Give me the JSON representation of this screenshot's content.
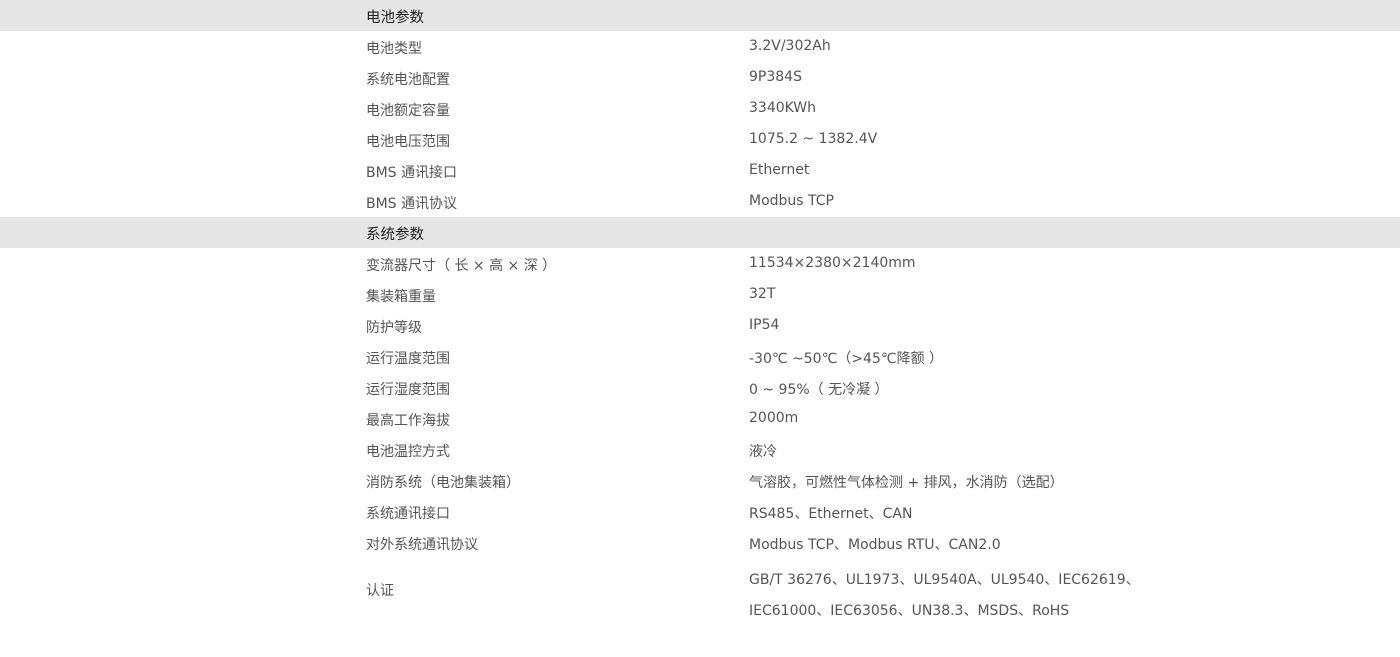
{
  "sections": [
    {
      "title": "电池参数",
      "rows": [
        {
          "label": "电池类型",
          "value": "3.2V/302Ah"
        },
        {
          "label": "系统电池配置",
          "value": "9P384S"
        },
        {
          "label": "电池额定容量",
          "value": "3340KWh"
        },
        {
          "label": "电池电压范围",
          "value": "1075.2 ~ 1382.4V"
        },
        {
          "label": "BMS  通讯接口",
          "value": "Ethernet"
        },
        {
          "label": "BMS  通讯协议",
          "value": "Modbus TCP"
        }
      ]
    },
    {
      "title": "系统参数",
      "rows": [
        {
          "label": "变流器尺寸（ 长  ×  高  ×  深 ）",
          "value": "11534×2380×2140mm"
        },
        {
          "label": "集装箱重量",
          "value": "32T"
        },
        {
          "label": "防护等级",
          "value": "IP54"
        },
        {
          "label": "运行温度范围",
          "value": "-30℃  ~50℃（>45℃降额 ）"
        },
        {
          "label": "运行湿度范围",
          "value": "0 ~ 95%（ 无冷凝 ）"
        },
        {
          "label": "最高工作海拔",
          "value": "2000m"
        },
        {
          "label": "电池温控方式",
          "value": "液冷"
        },
        {
          "label": "消防系统（电池集装箱）",
          "value": "气溶胶，可燃性气体检测  +  排风，水消防（选配）"
        },
        {
          "label": "系统通讯接口",
          "value": "RS485、Ethernet、CAN"
        },
        {
          "label": "对外系统通讯协议",
          "value": "Modbus TCP、Modbus RTU、CAN2.0"
        },
        {
          "label": "认证",
          "value": "GB/T 36276、UL1973、UL9540A、UL9540、IEC62619、IEC61000、IEC63056、UN38.3、MSDS、RoHS"
        }
      ]
    }
  ]
}
